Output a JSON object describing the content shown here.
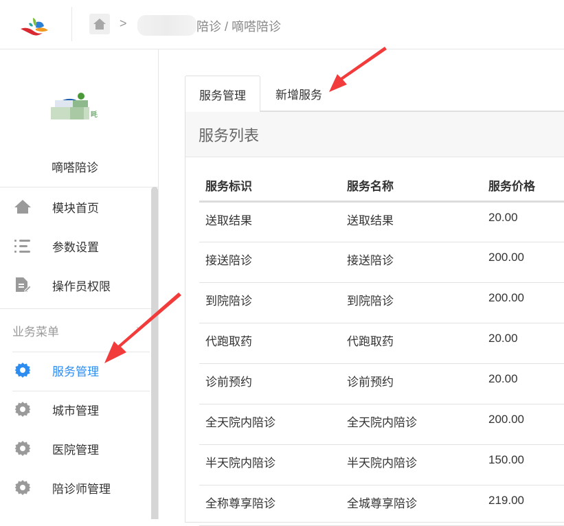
{
  "header": {
    "breadcrumb_sep": ">",
    "breadcrumb_text": "陪诊 / 嘀嗒陪诊",
    "icons": {
      "logo": "app-logo",
      "home": "home-icon"
    }
  },
  "sidebar": {
    "site_name": "嘀嗒陪诊",
    "top_items": [
      {
        "label": "模块首页",
        "icon": "home-icon"
      },
      {
        "label": "参数设置",
        "icon": "list-icon"
      },
      {
        "label": "操作员权限",
        "icon": "document-edit-icon"
      }
    ],
    "group_label": "业务菜单",
    "group_arrow": "›",
    "group_items": [
      {
        "label": "服务管理",
        "icon": "gear-icon",
        "active": true
      },
      {
        "label": "城市管理",
        "icon": "gear-icon",
        "active": false
      },
      {
        "label": "医院管理",
        "icon": "gear-icon",
        "active": false
      },
      {
        "label": "陪诊师管理",
        "icon": "gear-icon",
        "active": false
      }
    ]
  },
  "main": {
    "tabs": [
      {
        "label": "服务管理",
        "active": true
      },
      {
        "label": "新增服务",
        "active": false
      }
    ],
    "panel_title": "服务列表",
    "table": {
      "columns": [
        "服务标识",
        "服务名称",
        "服务价格"
      ],
      "rows": [
        [
          "送取结果",
          "送取结果",
          "20.00"
        ],
        [
          "接送陪诊",
          "接送陪诊",
          "200.00"
        ],
        [
          "到院陪诊",
          "到院陪诊",
          "200.00"
        ],
        [
          "代跑取药",
          "代跑取药",
          "20.00"
        ],
        [
          "诊前预约",
          "诊前预约",
          "20.00"
        ],
        [
          "全天院内陪诊",
          "全天院内陪诊",
          "200.00"
        ],
        [
          "半天院内陪诊",
          "半天院内陪诊",
          "150.00"
        ],
        [
          "全称尊享陪诊",
          "全城尊享陪诊",
          "219.00"
        ]
      ]
    }
  },
  "colors": {
    "accent": "#2d8cf0",
    "annotation_arrow": "#f23b3b",
    "icon_gray": "#9a9a9a"
  }
}
